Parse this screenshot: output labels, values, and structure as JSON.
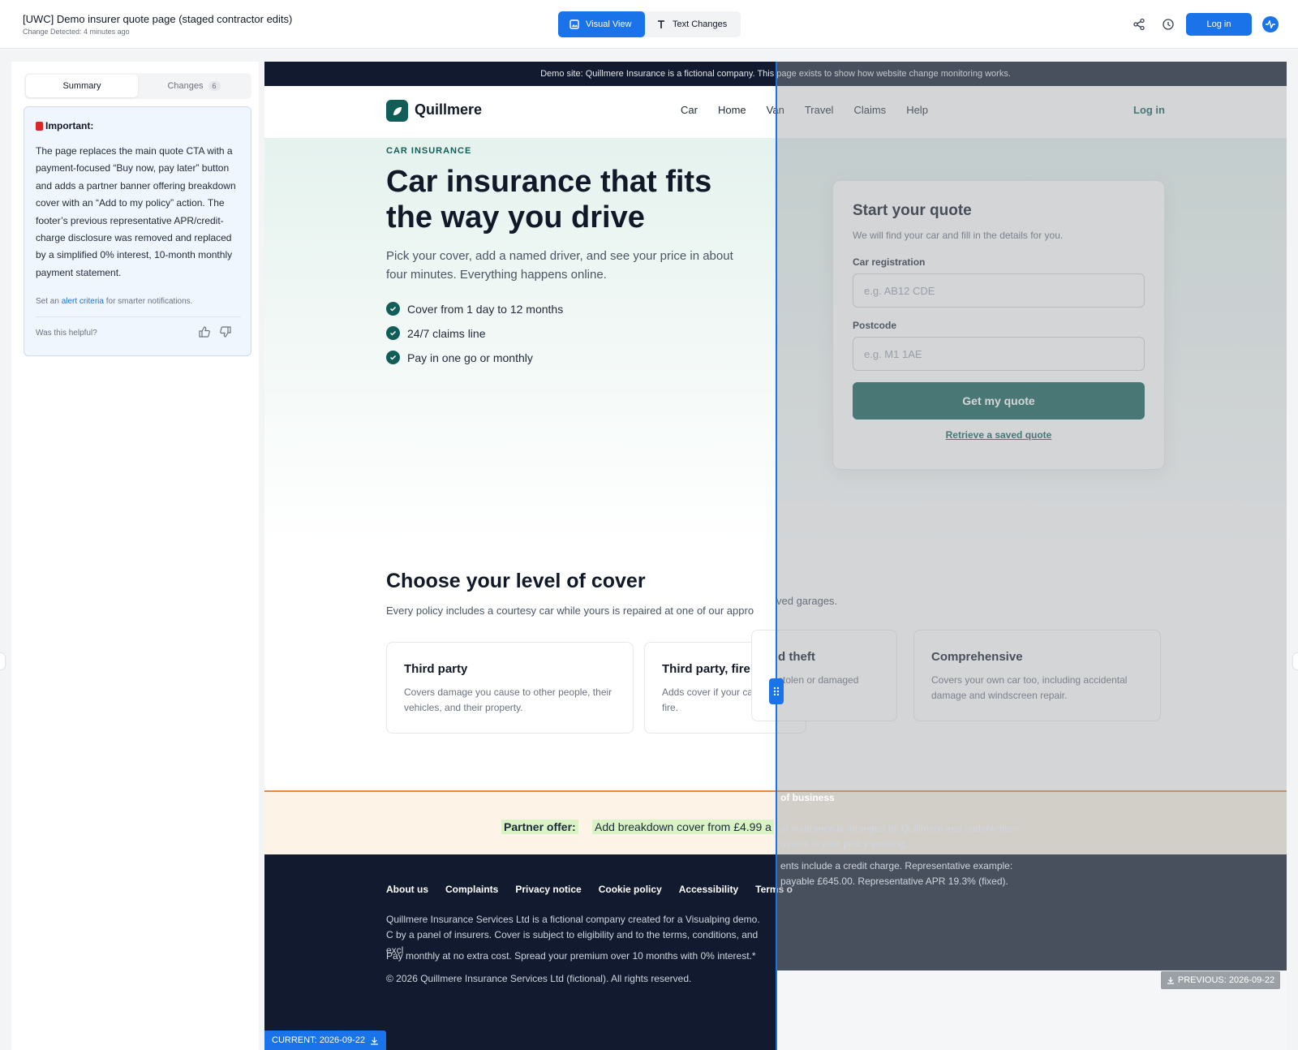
{
  "topbar": {
    "title": "[UWC] Demo insurer quote page (staged contractor edits)",
    "subtitle": "Change Detected: 4 minutes ago",
    "visual_view": "Visual View",
    "text_changes": "Text Changes",
    "login": "Log in",
    "icons": [
      "share-icon",
      "history-icon",
      "activity-icon"
    ]
  },
  "sidebar": {
    "tabs": [
      {
        "label": "Summary"
      },
      {
        "label": "Changes",
        "count": "6"
      }
    ],
    "important_label": "Important:",
    "summary": "The page replaces the main quote CTA with a payment-focused “Buy now, pay later” button and adds a partner banner offering breakdown cover with an “Add to my policy” action. The footer’s previous representative APR/credit-charge disclosure was removed and replaced by a simplified 0% interest, 10-month monthly payment statement.",
    "alert_prefix": "Set an",
    "alert_link": "alert criteria",
    "alert_suffix": "for smarter notifications.",
    "helpful": "Was this helpful?"
  },
  "preview": {
    "banner": "Demo site: Quillmere Insurance is a fictional company. This page exists to show how website change monitoring works.",
    "brand": "Quillmere",
    "nav": [
      "Car",
      "Home",
      "Van",
      "Travel",
      "Claims",
      "Help"
    ],
    "nav_login": "Log in",
    "eyebrow": "CAR INSURANCE",
    "headline": "Car insurance that fits the way you drive",
    "lead": "Pick your cover, add a named driver, and see your price in about four minutes. Everything happens online.",
    "checks": [
      "Cover from 1 day to 12 months",
      "24/7 claims line",
      "Pay in one go or monthly"
    ],
    "quote": {
      "title": "Start your quote",
      "subtitle": "We will find your car and fill in the details for you.",
      "reg_label": "Car registration",
      "reg_placeholder": "e.g. AB12 CDE",
      "post_label": "Postcode",
      "post_placeholder": "e.g. M1 1AE",
      "cta": "Get my quote",
      "retrieve": "Retrieve a saved quote"
    },
    "cover_title": "Choose your level of cover",
    "cover_sub": "Every policy includes a courtesy car while yours is repaired at one of our approved garages.",
    "cover_left_sub": "Every policy includes a courtesy car while yours is repaired at one of our appro",
    "cover_right_sub": "ved garages.",
    "cards": [
      {
        "title": "Third party",
        "desc": "Covers damage you cause to other people, their vehicles, and their property."
      },
      {
        "title": "Third party, fire ar",
        "desc": "Adds cover if your ca by fire."
      },
      {
        "title": "d theft",
        "desc": "stolen or damaged"
      },
      {
        "title": "Comprehensive",
        "desc": "Covers your own car too, including accidental damage and windscreen repair."
      }
    ],
    "partner_label": "Partner offer:",
    "partner_text": "Add breakdown cover from £4.99 a",
    "footer_links": [
      "About us",
      "Complaints",
      "Privacy notice",
      "Cookie policy",
      "Accessibility",
      "Terms o"
    ],
    "footer_p1": "Quillmere Insurance Services Ltd is a fictional company created for a Visualping demo. C by a panel of insurers. Cover is subject to eligibility and to the terms, conditions, and excl",
    "footer_p2": "Pay monthly at no extra cost. Spread your premium over 10 months with 0% interest.*",
    "footer_p3": "© 2026 Quillmere Insurance Services Ltd (fictional). All rights reserved.",
    "right_heading": "of business",
    "right_p1": "ar insurance is arranged by Quillmere and underwritten usions in your policy wording.",
    "right_p2": "ents include a credit charge. Representative example: payable £645.00. Representative APR 19.3% (fixed).",
    "tag_previous": "PREVIOUS: 2026-09-22",
    "tag_current": "CURRENT: 2026-09-22"
  }
}
